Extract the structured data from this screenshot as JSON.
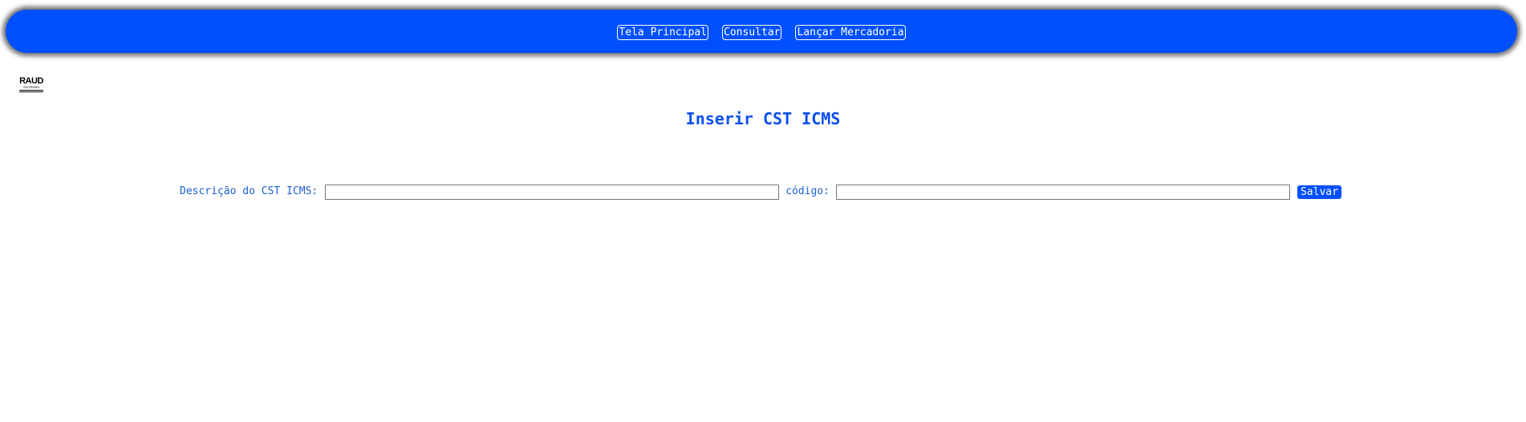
{
  "nav": {
    "items": [
      {
        "label": "Tela Principal"
      },
      {
        "label": "Consultar"
      },
      {
        "label": "Lançar Mercadoria"
      }
    ]
  },
  "logo": {
    "main": "RAUD",
    "sub": "SISTEMAS"
  },
  "page": {
    "title": "Inserir CST ICMS"
  },
  "form": {
    "description_label": "Descrição do CST ICMS:",
    "description_value": "",
    "code_label": "código:",
    "code_value": "",
    "save_label": "Salvar"
  },
  "colors": {
    "accent": "#0050ff",
    "text_blue": "#1a5fd0"
  }
}
